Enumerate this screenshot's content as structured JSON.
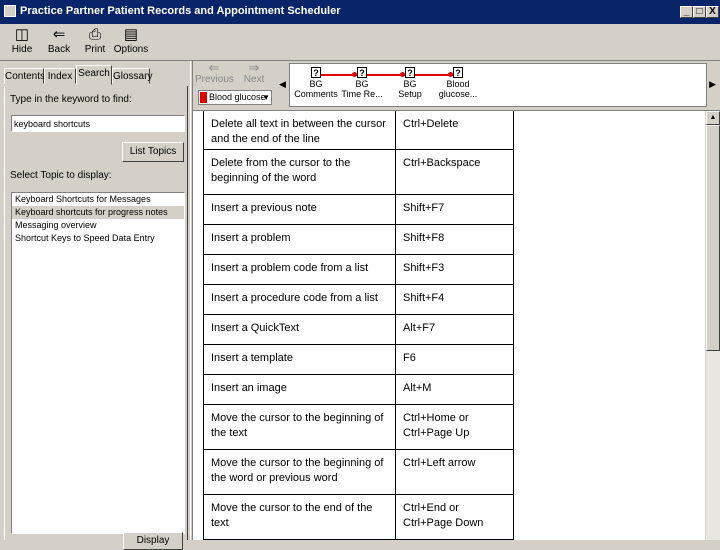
{
  "window": {
    "title": "Practice Partner Patient Records and Appointment Scheduler",
    "minimize": "_",
    "maximize": "□",
    "close": "X"
  },
  "toolbar": {
    "hide": "Hide",
    "back": "Back",
    "print": "Print",
    "options": "Options"
  },
  "tabs": [
    "Contents",
    "Index",
    "Search",
    "Glossary"
  ],
  "search": {
    "keyword_label": "Type in the keyword to find:",
    "keyword_value": "keyboard shortcuts",
    "list_topics": "List Topics",
    "topic_label": "Select Topic to display:",
    "topics": [
      "Keyboard Shortcuts for Messages",
      "Keyboard shortcuts for progress notes",
      "Messaging overview",
      "Shortcut Keys to Speed Data Entry"
    ],
    "display_button": "Display"
  },
  "nav": {
    "previous": "Previous",
    "next": "Next",
    "bg_select": "Blood glucose"
  },
  "flow_nodes": [
    [
      "BG",
      "Comments"
    ],
    [
      "BG",
      "Time Re..."
    ],
    [
      "BG",
      "Setup"
    ],
    [
      "Blood",
      "glucose..."
    ]
  ],
  "shortcuts": [
    [
      "Delete all text in between the cursor and the end of the line",
      "Ctrl+Delete"
    ],
    [
      "Delete from the cursor to the beginning of the word",
      "Ctrl+Backspace"
    ],
    [
      "Insert a previous note",
      "Shift+F7"
    ],
    [
      "Insert a problem",
      "Shift+F8"
    ],
    [
      "Insert a problem code from a list",
      "Shift+F3"
    ],
    [
      "Insert a procedure code from a list",
      "Shift+F4"
    ],
    [
      "Insert a QuickText",
      "Alt+F7"
    ],
    [
      "Insert a template",
      "F6"
    ],
    [
      "Insert an image",
      "Alt+M"
    ],
    [
      "Move the cursor to the beginning of the text",
      "Ctrl+Home or Ctrl+Page Up"
    ],
    [
      "Move the cursor to the beginning of the word or previous word",
      "Ctrl+Left arrow"
    ],
    [
      "Move the cursor to the end of the text",
      "Ctrl+End or Ctrl+Page Down"
    ]
  ]
}
